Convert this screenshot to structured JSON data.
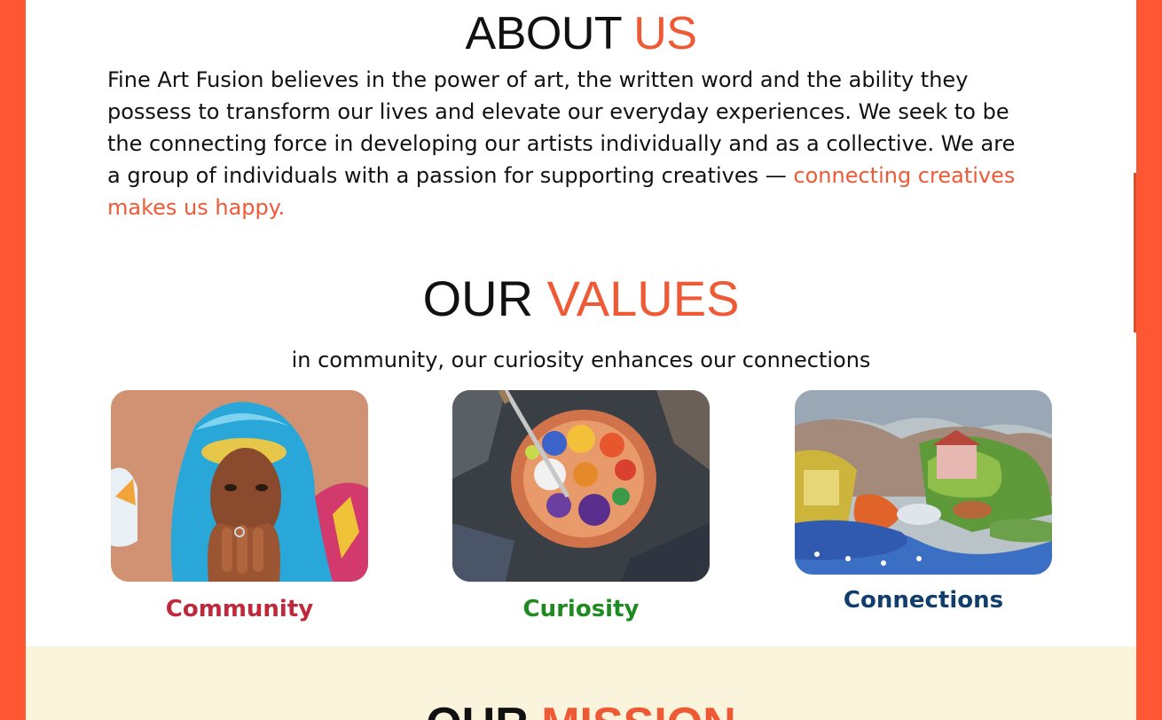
{
  "about": {
    "title_main": "ABOUT",
    "title_accent": "US",
    "body": "Fine Art Fusion believes in the power of art, the written word and the ability they possess to transform our lives and elevate our everyday experiences. We seek to be the connecting force in developing our artists individually and as a collective. We are a group of individuals with a passion for supporting creatives — ",
    "body_accent": "connecting creatives makes us happy."
  },
  "values": {
    "title_main": "OUR",
    "title_accent": "VALUES",
    "subtitle": "in community, our curiosity enhances our connections",
    "cards": [
      {
        "label": "Community",
        "color": "#c0283c"
      },
      {
        "label": "Curiosity",
        "color": "#1f8a1f"
      },
      {
        "label": "Connections",
        "color": "#123e6b"
      }
    ]
  },
  "mission": {
    "title_main": "OUR",
    "title_accent": "MISSION"
  },
  "colors": {
    "frame": "#ff5733",
    "accent": "#ef5a36",
    "mission_bg": "#fbf4dc"
  }
}
